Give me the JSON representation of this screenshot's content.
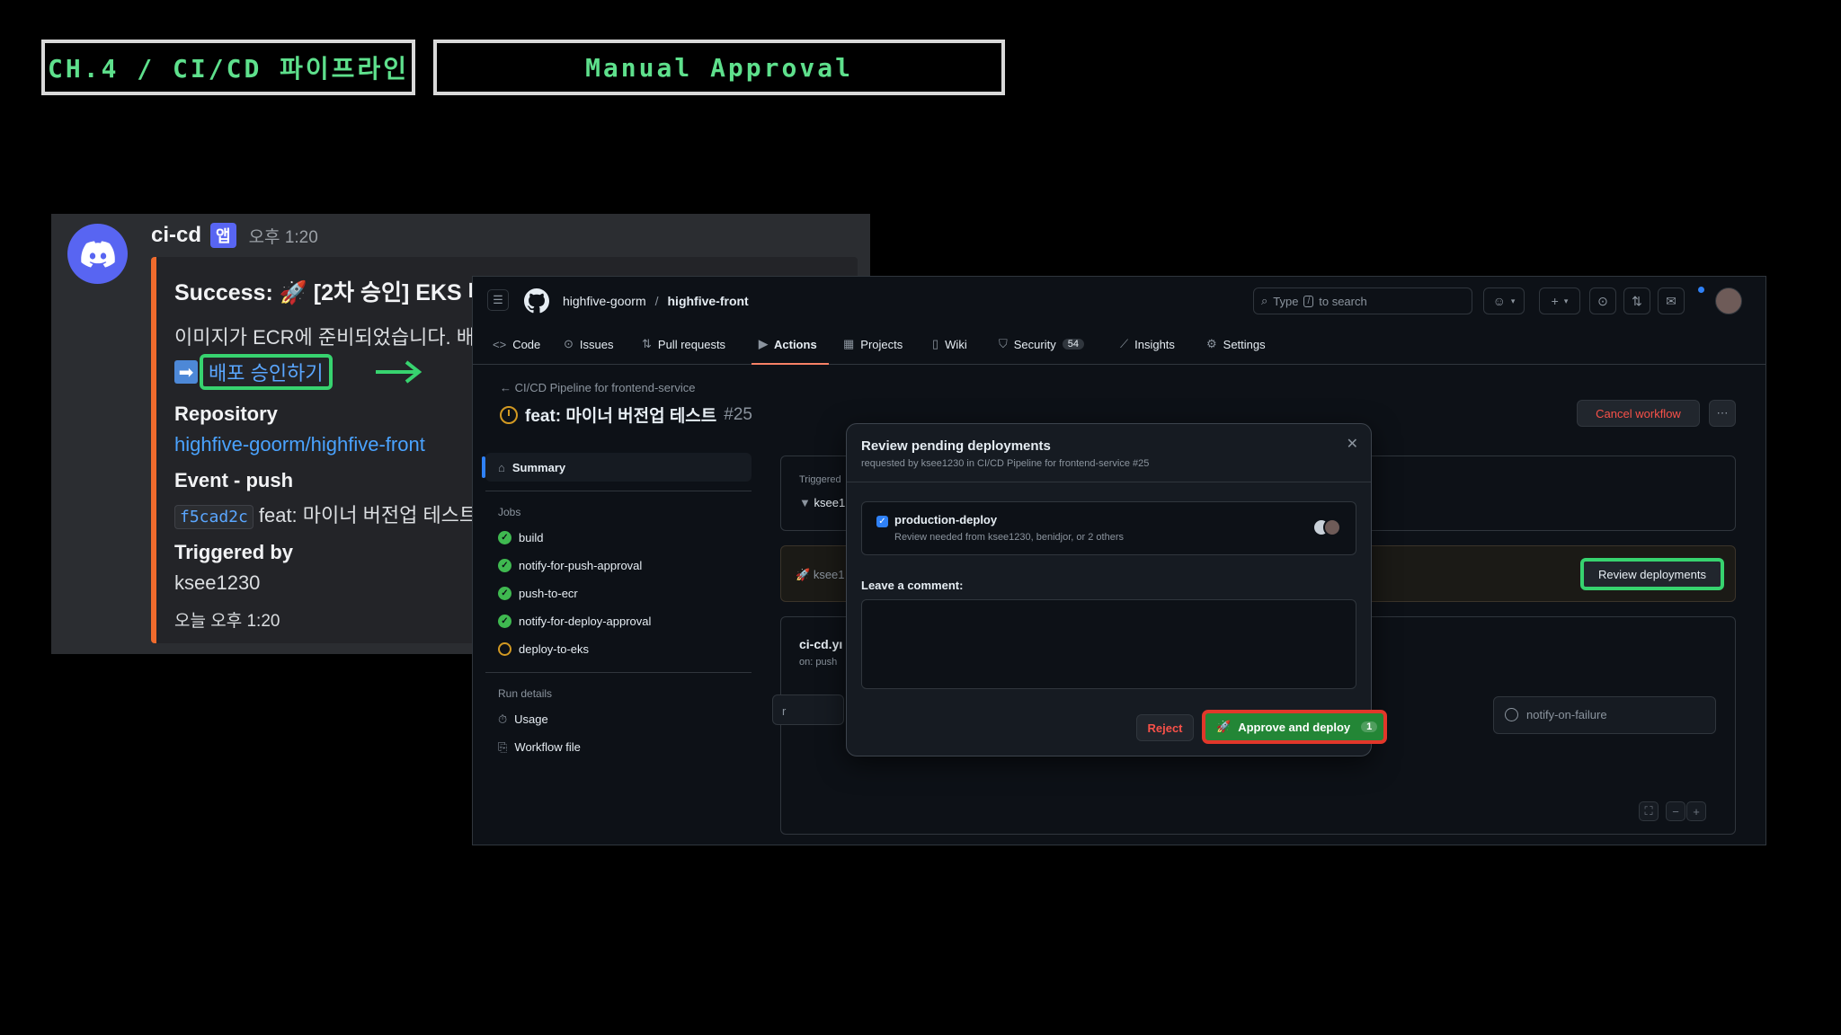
{
  "slide": {
    "chapter_label": "CH.4 / CI/CD 파이프라인",
    "topic_label": "Manual Approval"
  },
  "discord": {
    "bot_name": "ci-cd",
    "app_badge": "앱",
    "time": "오후 1:20",
    "embed": {
      "title": "Success: 🚀 [2차 승인] EKS 배",
      "description": "이미지가 ECR에 준비되었습니다. 배포",
      "approve_link": "배포 승인하기",
      "repo_label": "Repository",
      "repo_value": "highfive-goorm/highfive-front",
      "event_label": "Event - push",
      "commit_sha": "f5cad2c",
      "commit_msg": "feat: 마이너 버전업 테스트",
      "triggered_label": "Triggered by",
      "triggered_value": "ksee1230",
      "footer": "오늘 오후 1:20"
    }
  },
  "github": {
    "org": "highfive-goorm",
    "separator": "/",
    "repo": "highfive-front",
    "search_placeholder_pre": "Type",
    "search_key": "/",
    "search_placeholder_post": "to search",
    "tabs": [
      {
        "label": "Code",
        "icon": "<>"
      },
      {
        "label": "Issues",
        "icon": "⊙"
      },
      {
        "label": "Pull requests",
        "icon": "⇅"
      },
      {
        "label": "Actions",
        "icon": "▶"
      },
      {
        "label": "Projects",
        "icon": "▦"
      },
      {
        "label": "Wiki",
        "icon": "▯"
      },
      {
        "label": "Security",
        "icon": "⛉",
        "count": "54"
      },
      {
        "label": "Insights",
        "icon": "⟋"
      },
      {
        "label": "Settings",
        "icon": "⚙"
      }
    ],
    "back_link": "CI/CD Pipeline for frontend-service",
    "run_title": "feat: 마이너 버전업 테스트",
    "run_number": "#25",
    "cancel_label": "Cancel workflow",
    "sidebar": {
      "summary": "Summary",
      "jobs_heading": "Jobs",
      "jobs": [
        {
          "name": "build",
          "status": "success"
        },
        {
          "name": "notify-for-push-approval",
          "status": "success"
        },
        {
          "name": "push-to-ecr",
          "status": "success"
        },
        {
          "name": "notify-for-deploy-approval",
          "status": "success"
        },
        {
          "name": "deploy-to-eks",
          "status": "waiting"
        }
      ],
      "run_details_heading": "Run details",
      "usage": "Usage",
      "workflow_file": "Workflow file"
    },
    "triggered_label": "Triggered",
    "triggered_user": "ksee1",
    "waiting_user": "ksee1",
    "review_button": "Review deployments",
    "graph": {
      "file": "ci-cd.yı",
      "on": "on: push",
      "partial_left": "r",
      "partial_review": "view",
      "notify_failure": "notify-on-failure"
    },
    "modal": {
      "title": "Review pending deployments",
      "subtitle": "requested by ksee1230 in CI/CD Pipeline for frontend-service #25",
      "env_name": "production-deploy",
      "env_note": "Review needed from ksee1230, benidjor, or 2 others",
      "comment_label": "Leave a comment:",
      "reject_label": "Reject",
      "approve_label": "Approve and deploy",
      "approve_count": "1"
    }
  },
  "colors": {
    "accent_green": "#5ee08c",
    "highlight_green": "#37d36f",
    "highlight_red": "#e2372a",
    "discord_blurple": "#5865f2",
    "embed_bar": "#f06b2d"
  }
}
